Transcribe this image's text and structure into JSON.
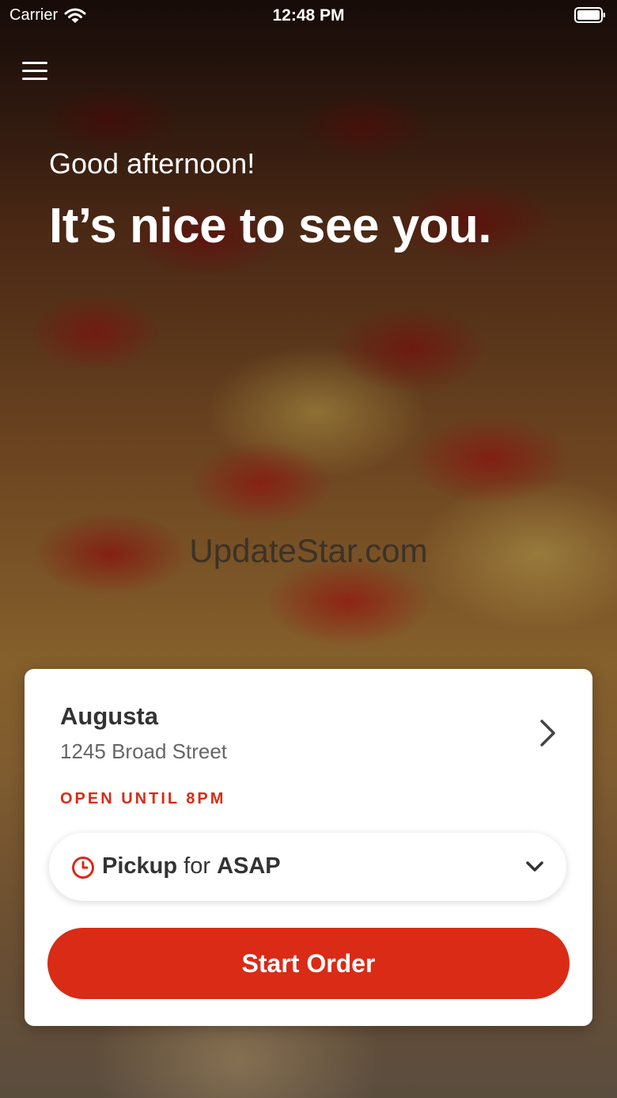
{
  "status_bar": {
    "carrier": "Carrier",
    "time": "12:48 PM"
  },
  "hero": {
    "greeting": "Good afternoon!",
    "headline": "It’s nice to see you."
  },
  "watermark": "UpdateStar.com",
  "location_card": {
    "name": "Augusta",
    "address": "1245 Broad Street",
    "hours": "OPEN UNTIL 8PM",
    "order_type": {
      "mode": "Pickup",
      "connector": "for",
      "time": "ASAP"
    },
    "start_button_label": "Start Order"
  },
  "colors": {
    "accent": "#d92b16"
  },
  "icons": [
    "wifi-icon",
    "battery-icon",
    "menu-icon",
    "chevron-right-icon",
    "clock-icon",
    "chevron-down-icon"
  ]
}
